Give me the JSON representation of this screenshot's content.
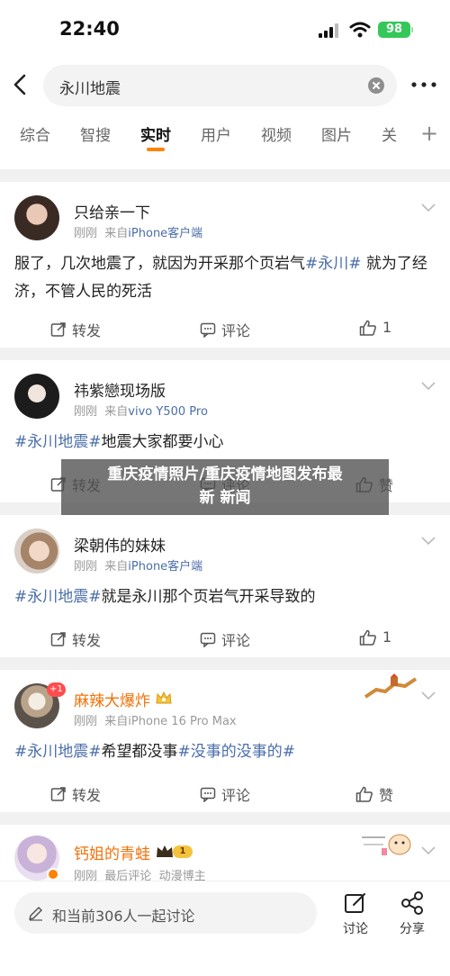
{
  "status": {
    "time": "22:40",
    "battery": "98"
  },
  "search": {
    "query": "永川地震"
  },
  "tabs": [
    {
      "label": "综合"
    },
    {
      "label": "智搜"
    },
    {
      "label": "实时"
    },
    {
      "label": "用户"
    },
    {
      "label": "视频"
    },
    {
      "label": "图片"
    },
    {
      "label": "关"
    }
  ],
  "posts": [
    {
      "user": "只给亲一下",
      "time": "刚刚",
      "source_prefix": "来自",
      "source": "iPhone客户端",
      "text_plain": "服了，几次地震了，就因为开采那个页岩气",
      "tag": "#永川#",
      "text_tail": " 就为了经济，不管人民的死活",
      "repost": "转发",
      "comment": "评论",
      "like": "1"
    },
    {
      "user": "祎紫戀现场版",
      "time": "刚刚",
      "source_prefix": "来自",
      "source": "vivo Y500 Pro",
      "tag": "#永川地震#",
      "text_plain": "地震大家都要小心",
      "repost": "转发",
      "comment": "评论",
      "like": "赞"
    },
    {
      "user": "梁朝伟的妹妹",
      "time": "刚刚",
      "source_prefix": "来自",
      "source": "iPhone客户端",
      "tag": "#永川地震#",
      "text_plain": "就是永川那个页岩气开采导致的",
      "repost": "转发",
      "comment": "评论",
      "like": "1"
    },
    {
      "user": "麻辣大爆炸",
      "time": "刚刚",
      "source_prefix": "来自",
      "source": "iPhone 16 Pro Max",
      "tag": "#永川地震#",
      "text_plain": "希望都没事",
      "tag2": "#没事的没事的#",
      "badge": "+1",
      "repost": "转发",
      "comment": "评论",
      "like": "赞"
    },
    {
      "user": "钙姐的青蛙",
      "time": "刚刚",
      "extra": "最后评论",
      "category": "动漫博主",
      "level": "1"
    }
  ],
  "overlay": {
    "line1": "重庆疫情照片/重庆疫情地图发布最",
    "line2": "新 新闻"
  },
  "bottom": {
    "placeholder": "和当前306人一起讨论",
    "comment_label": "讨论",
    "share_label": "分享"
  },
  "colors": {
    "accent": "#ff8200",
    "link": "#4a6ea8",
    "battery": "#34c759"
  }
}
